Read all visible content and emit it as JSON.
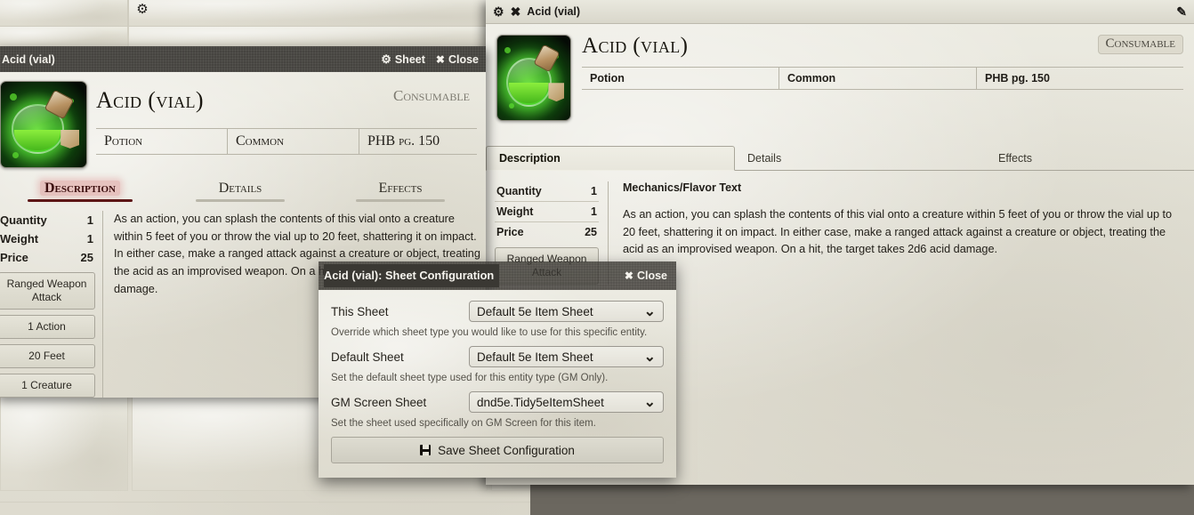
{
  "background_window": {
    "gear_icon": "gear-icon"
  },
  "right_window": {
    "titlebar": {
      "gear_icon": "gear-icon",
      "close_icon": "close-circle-icon",
      "title": "Acid (vial)",
      "edit_icon": "edit-square-icon"
    },
    "item": {
      "name": "Acid (vial)",
      "badge": "Consumable",
      "meta": [
        "Potion",
        "Common",
        "PHB pg. 150"
      ],
      "portrait_icon": "green-potion-vial-icon"
    },
    "tabs": [
      {
        "label": "Description",
        "active": true
      },
      {
        "label": "Details",
        "active": false
      },
      {
        "label": "Effects",
        "active": false
      }
    ],
    "stats": [
      {
        "label": "Quantity",
        "value": "1"
      },
      {
        "label": "Weight",
        "value": "1"
      },
      {
        "label": "Price",
        "value": "25"
      }
    ],
    "tag_buttons": [
      "Ranged Weapon Attack"
    ],
    "description_heading": "Mechanics/Flavor Text",
    "description_text": "As an action, you can splash the contents of this vial onto a creature within 5 feet of you or throw the vial up to 20 feet, shattering it on impact. In either case, make a ranged attack against a creature or object, treating the acid as an improvised weapon. On a hit, the target takes 2d6 acid damage."
  },
  "left_window": {
    "titlebar": {
      "title": "Acid (vial)",
      "sheet_label": "Sheet",
      "sheet_icon": "gear-icon",
      "close_label": "Close",
      "close_icon": "x-icon"
    },
    "item": {
      "name": "Acid (vial)",
      "badge": "Consumable",
      "meta": [
        "Potion",
        "Common",
        "PHB pg. 150"
      ],
      "portrait_icon": "green-potion-vial-icon"
    },
    "tabs": [
      {
        "label": "Description",
        "active": true
      },
      {
        "label": "Details",
        "active": false
      },
      {
        "label": "Effects",
        "active": false
      }
    ],
    "stats": [
      {
        "label": "Quantity",
        "value": "1"
      },
      {
        "label": "Weight",
        "value": "1"
      },
      {
        "label": "Price",
        "value": "25"
      }
    ],
    "tag_buttons": [
      "Ranged Weapon Attack",
      "1 Action",
      "20 Feet",
      "1 Creature"
    ],
    "description_text": "As an action, you can splash the contents of this vial onto a creature within 5 feet of you or throw the vial up to 20 feet, shattering it on impact. In either case, make a ranged attack against a creature or object, treating the acid as an improvised weapon. On a hit, the target takes 2d6 acid damage."
  },
  "dialog": {
    "title": "Acid (vial): Sheet Configuration",
    "close_label": "Close",
    "close_icon": "x-icon",
    "fields": [
      {
        "label": "This Sheet",
        "value": "Default 5e Item Sheet",
        "hint": "Override which sheet type you would like to use for this specific entity."
      },
      {
        "label": "Default Sheet",
        "value": "Default 5e Item Sheet",
        "hint": "Set the default sheet type used for this entity type (GM Only)."
      },
      {
        "label": "GM Screen Sheet",
        "value": "dnd5e.Tidy5eItemSheet",
        "hint": "Set the sheet used specifically on GM Screen for this item."
      }
    ],
    "save_label": "Save Sheet Configuration",
    "save_icon": "floppy-disk-icon"
  },
  "colors": {
    "parchment": "#e7e5da",
    "dark_bar": "#4b4944",
    "active_tab_accent": "#5d1616",
    "active_tab_glow": "#d67a7a"
  }
}
